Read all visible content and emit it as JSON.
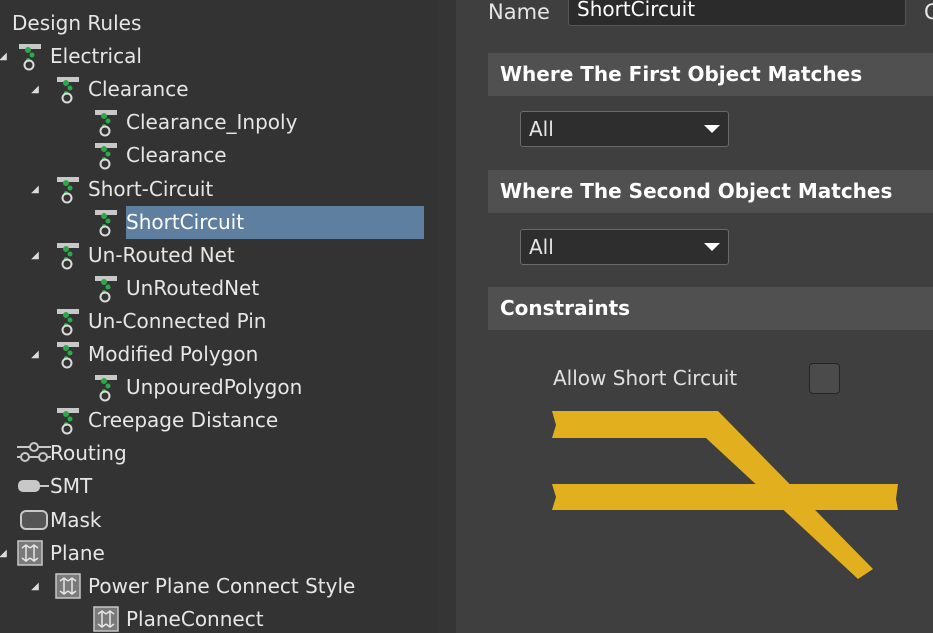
{
  "tree": {
    "items": [
      {
        "label": "Design Rules",
        "icon": "folder-icon",
        "level": 0,
        "toggle": ""
      },
      {
        "label": "Electrical",
        "icon": "rule-category-icon",
        "level": 1,
        "toggle": "expanded"
      },
      {
        "label": "Clearance",
        "icon": "rule-category-icon",
        "level": 2,
        "toggle": "expanded"
      },
      {
        "label": "Clearance_Inpoly",
        "icon": "rule-icon",
        "level": 3,
        "toggle": ""
      },
      {
        "label": "Clearance",
        "icon": "rule-icon",
        "level": 3,
        "toggle": ""
      },
      {
        "label": "Short-Circuit",
        "icon": "rule-category-icon",
        "level": 2,
        "toggle": "expanded"
      },
      {
        "label": "ShortCircuit",
        "icon": "rule-icon",
        "level": 3,
        "toggle": "",
        "selected": true
      },
      {
        "label": "Un-Routed Net",
        "icon": "rule-category-icon",
        "level": 2,
        "toggle": "expanded"
      },
      {
        "label": "UnRoutedNet",
        "icon": "rule-icon",
        "level": 3,
        "toggle": ""
      },
      {
        "label": "Un-Connected Pin",
        "icon": "rule-category-icon",
        "level": 2,
        "toggle": ""
      },
      {
        "label": "Modified Polygon",
        "icon": "rule-category-icon",
        "level": 2,
        "toggle": "expanded"
      },
      {
        "label": "UnpouredPolygon",
        "icon": "rule-icon",
        "level": 3,
        "toggle": ""
      },
      {
        "label": "Creepage Distance",
        "icon": "rule-category-icon",
        "level": 2,
        "toggle": ""
      },
      {
        "label": "Routing",
        "icon": "routing-icon",
        "level": 1,
        "toggle": ""
      },
      {
        "label": "SMT",
        "icon": "smt-icon",
        "level": 1,
        "toggle": ""
      },
      {
        "label": "Mask",
        "icon": "mask-icon",
        "level": 1,
        "toggle": ""
      },
      {
        "label": "Plane",
        "icon": "plane-icon",
        "level": 1,
        "toggle": "expanded"
      },
      {
        "label": "Power Plane Connect Style",
        "icon": "plane-icon",
        "level": 2,
        "toggle": "expanded"
      },
      {
        "label": "PlaneConnect",
        "icon": "plane-icon",
        "level": 3,
        "toggle": ""
      }
    ]
  },
  "properties": {
    "name_label": "Name",
    "name_value": "ShortCircuit",
    "cut_label": "C",
    "first_match_title": "Where The First Object Matches",
    "first_match_value": "All",
    "second_match_title": "Where The Second Object Matches",
    "second_match_value": "All",
    "constraints_title": "Constraints",
    "allow_short_label": "Allow Short Circuit",
    "allow_short_checked": false
  },
  "colors": {
    "selection": "#5e7f9f",
    "trace": "#e2b01e",
    "section_bg": "#505050"
  }
}
